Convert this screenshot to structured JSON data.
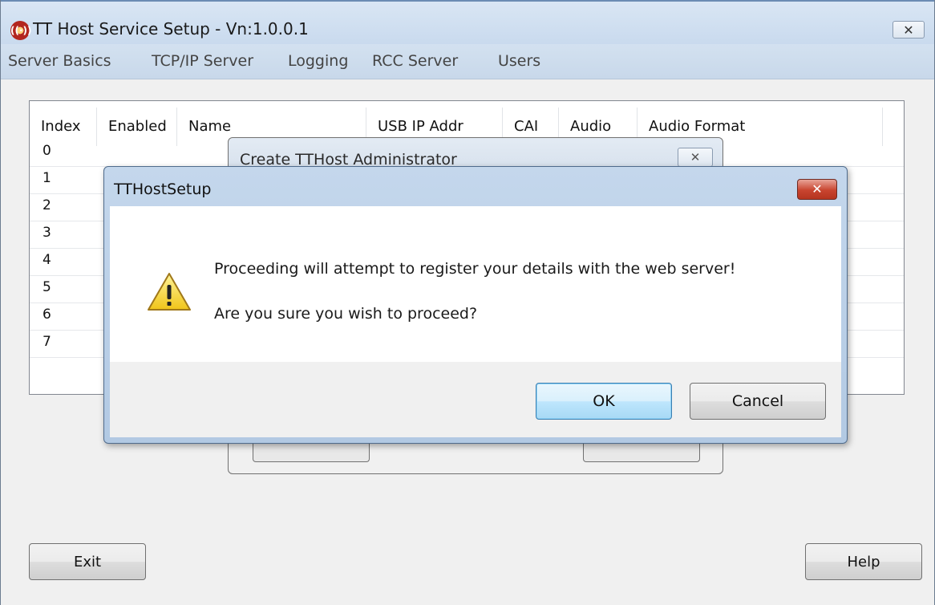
{
  "app": {
    "title": "TT Host Service Setup - Vn:1.0.0.1",
    "icon": "radio-tower-icon",
    "close_glyph": "✕"
  },
  "menu": {
    "items": [
      "Server Basics",
      "TCP/IP Server",
      "Logging",
      "RCC Server",
      "Users"
    ]
  },
  "table": {
    "columns": [
      "Index",
      "Enabled",
      "Name",
      "USB IP Addr",
      "CAI",
      "Audio",
      "Audio Format"
    ],
    "rows": [
      "0",
      "1",
      "2",
      "3",
      "4",
      "5",
      "6",
      "7"
    ]
  },
  "background_dialog": {
    "title": "Create TTHost Administrator",
    "close_glyph": "✕"
  },
  "message_box": {
    "title": "TTHostSetup",
    "close_glyph": "✕",
    "icon": "warning-icon",
    "line1": "Proceeding will attempt to register your details with the web server!",
    "line2": "Are you sure you wish to proceed?",
    "ok_label": "OK",
    "cancel_label": "Cancel"
  },
  "buttons": {
    "exit_label": "Exit",
    "help_label": "Help"
  }
}
